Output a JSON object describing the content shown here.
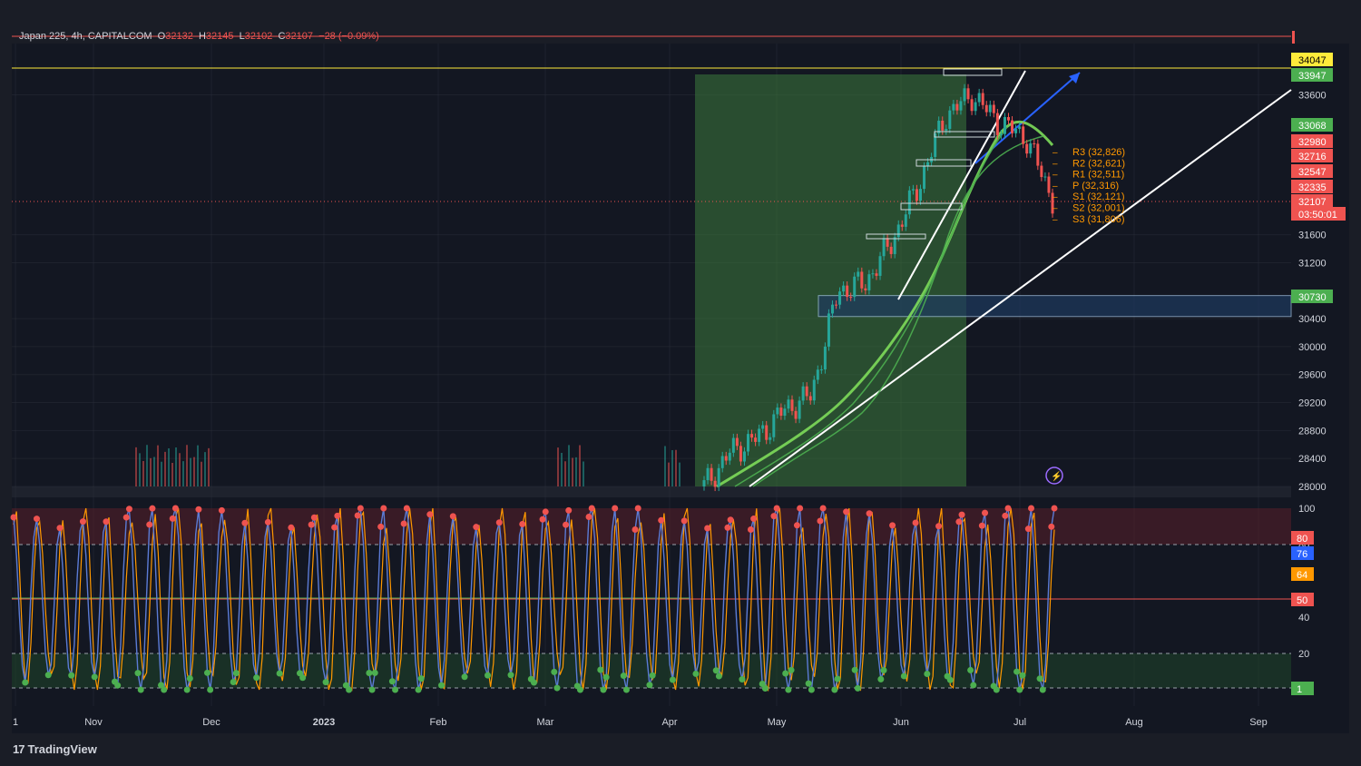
{
  "header": {
    "symbol": "Japan 225, 4h, CAPITALCOM",
    "open_label": "O",
    "open": "32132",
    "high_label": "H",
    "high": "32145",
    "low_label": "L",
    "low": "32102",
    "close_label": "C",
    "close": "32107",
    "change": "−28 (−0.09%)"
  },
  "branding": {
    "logo_text": "TradingView"
  },
  "colors": {
    "background": "#131722",
    "grid": "#2a2e39",
    "up": "#26a69a",
    "down": "#ef5350",
    "ribbon": "#4caf50",
    "highlight_zone": "#3d7a3d",
    "demand_zone": "#1e3a5f",
    "stoch_k": "#5b7bd5",
    "stoch_d": "#ff9800"
  },
  "chart_data": [
    {
      "type": "line",
      "title": "Japan 225, 4h, CAPITALCOM",
      "x_ticks": [
        "1",
        "Nov",
        "Dec",
        "2023",
        "Feb",
        "Mar",
        "Apr",
        "May",
        "Jun",
        "Jul",
        "Aug",
        "Sep"
      ],
      "y_ticks": [
        28000,
        28400,
        28800,
        29200,
        29600,
        30000,
        30400,
        31200,
        31600,
        33600
      ],
      "ylim": [
        28000,
        34100
      ],
      "grid": true,
      "price_series": {
        "name": "",
        "x": [
          "2023-04-10",
          "2023-04-17",
          "2023-04-24",
          "2023-05-01",
          "2023-05-08",
          "2023-05-15",
          "2023-05-22",
          "2023-05-29",
          "2023-06-05",
          "2023-06-12",
          "2023-06-19",
          "2023-06-26",
          "2023-07-03",
          "2023-07-10"
        ],
        "close": [
          28000,
          28500,
          28700,
          29100,
          29300,
          30800,
          30900,
          31500,
          32300,
          33300,
          33600,
          33200,
          33000,
          32107
        ]
      },
      "price_labels": [
        {
          "value": "34047",
          "color": "#ffeb3b"
        },
        {
          "value": "33947",
          "color": "#4caf50"
        },
        {
          "value": "33068",
          "color": "#4caf50"
        },
        {
          "value": "32980",
          "color": "#ef5350"
        },
        {
          "value": "32716",
          "color": "#ef5350"
        },
        {
          "value": "32547",
          "color": "#ef5350"
        },
        {
          "value": "32335",
          "color": "#ef5350"
        },
        {
          "value": "32107",
          "color": "#ef5350"
        },
        {
          "value": "03:50:01",
          "color": "#ef5350"
        },
        {
          "value": "30730",
          "color": "#4caf50"
        }
      ],
      "horizontal_levels": [
        {
          "value": 34047,
          "color": "#ffeb3b"
        },
        {
          "value": 32107,
          "color": "#ef5350",
          "style": "dotted"
        }
      ],
      "pivot_levels": [
        {
          "label": "R3 (32,826)",
          "value": 32826
        },
        {
          "label": "R2 (32,621)",
          "value": 32621
        },
        {
          "label": "R1 (32,511)",
          "value": 32511
        },
        {
          "label": "P (32,316)",
          "value": 32316
        },
        {
          "label": "S1 (32,121)",
          "value": 32121
        },
        {
          "label": "S2 (32,001)",
          "value": 32001
        },
        {
          "label": "S3 (31,806)",
          "value": 31806
        }
      ],
      "zones": [
        {
          "kind": "highlight",
          "x_start": "2023-04-10",
          "x_end": "2023-06-20"
        },
        {
          "kind": "demand",
          "y_top": 30730,
          "y_bottom": 30430
        }
      ]
    },
    {
      "type": "line",
      "title": "",
      "y_ticks": [
        100,
        80,
        40,
        20
      ],
      "ylim": [
        0,
        100
      ],
      "levels": [
        80,
        50,
        20,
        1
      ],
      "last_labels": [
        {
          "value": "80",
          "color": "#ef5350"
        },
        {
          "value": "76",
          "color": "#2962ff"
        },
        {
          "value": "64",
          "color": "#ff9800"
        },
        {
          "value": "50",
          "color": "#ef5350"
        },
        {
          "value": "1",
          "color": "#4caf50"
        }
      ],
      "series": [
        {
          "name": "",
          "color": "#5b7bd5"
        },
        {
          "name": "",
          "color": "#ff9800"
        }
      ],
      "oscillator_cycle": [
        95,
        70,
        35,
        8,
        2,
        20,
        60,
        90,
        98,
        80,
        45,
        15,
        3,
        12,
        48,
        85
      ]
    }
  ]
}
